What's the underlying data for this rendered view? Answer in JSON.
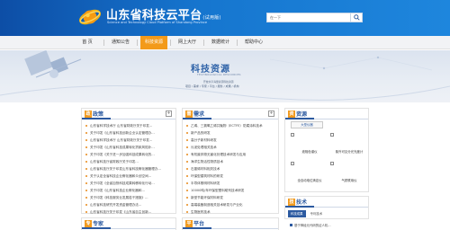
{
  "header": {
    "title": "山东省科技云平台",
    "trial": "(试用版)",
    "subtitle": "Science and Technology Cloud Platform of Shandong Province",
    "search_value": "在一下",
    "colors": {
      "header_start": "#0d4ea6",
      "header_end": "#1e86dd"
    },
    "search_icon": "magnifier-icon"
  },
  "nav": {
    "items": [
      {
        "label": "首 页"
      },
      {
        "label": "通知公告"
      },
      {
        "label": "科技资源"
      },
      {
        "label": "网上大厅"
      },
      {
        "label": "数据统计"
      },
      {
        "label": "帮助中心"
      }
    ],
    "active_index": 2,
    "active_color": "#f39a1a"
  },
  "banner": {
    "title": "科技资源",
    "en": "TECHNOLOGICAL RESOURCES",
    "desc": "开放共享海量资源科技资源",
    "tags": "项目 / 需求 / 专家 / 平台 / 服务 / 成果 / 机构"
  },
  "panels": {
    "policy": {
      "title": "政策",
      "icon": "政",
      "items": [
        "山东省科学技术厅 山东省财政厅关于印发...",
        "关于印发《山东省科技创新企业认定管理办...",
        "山东省科学技术厅 山东省财政厅关于印发...",
        "关于印发《山东省科技成果转化贷款风险补...",
        "关于印发《关于进一步加强科技成果转化的...",
        "山东省科技厅省财政厅关于印发...",
        "山东省科技厅关于印发山东省科技孵化器管理办...",
        "关于认定全省科技企业孵化器和众创空间...",
        "关于印发《全省加快科技成果转移转化行动...",
        "关于印发《山东省科技企业孵化器和...",
        "关于印发《科技服务业发展若干措施》...",
        "山东省科技研究开发资金管理办法...",
        "山东省科技厅关于印发《山东省自主创新...",
        "山东省科学技术厅关于印发山东省重点..."
      ]
    },
    "demand": {
      "title": "需求",
      "icon": "需",
      "items": [
        "乙烯、三氯氧乙烯共聚物（ECTFE）防腐涂料技术",
        "新产品的研发",
        "高分子新材料研发",
        "污泥处理相关技术",
        "有机废弃物无害化处理技术研发与应用",
        "海洋生物活性物质技术",
        "石墨烯材料相关技术",
        "环保型建筑材料的研发",
        "半导体照明材料研发",
        "10000吨/年环保型塑料助剂技术研发",
        "新型节能环保材料研发",
        "高端装备制造相关技术研发与产业化",
        "生物医药技术",
        "SHTC技术及装备研发"
      ]
    },
    "resources": {
      "title": "资源",
      "icon": "资",
      "tab": "大型仪器",
      "items": [
        {
          "caption": "液相色谱仪"
        },
        {
          "caption": "紫外可见分光光度计"
        },
        {
          "caption": "全自动电位滴定仪"
        },
        {
          "caption": "气质联用仪"
        }
      ]
    },
    "tech": {
      "title": "技术",
      "icon": "技",
      "tabs": [
        "科技成果",
        "专利技术"
      ],
      "active_tab": 0,
      "line": "基于神经元代码的证人机..."
    },
    "expert": {
      "title": "专家",
      "icon": "专"
    },
    "platform": {
      "title": "平台",
      "icon": "平"
    }
  }
}
